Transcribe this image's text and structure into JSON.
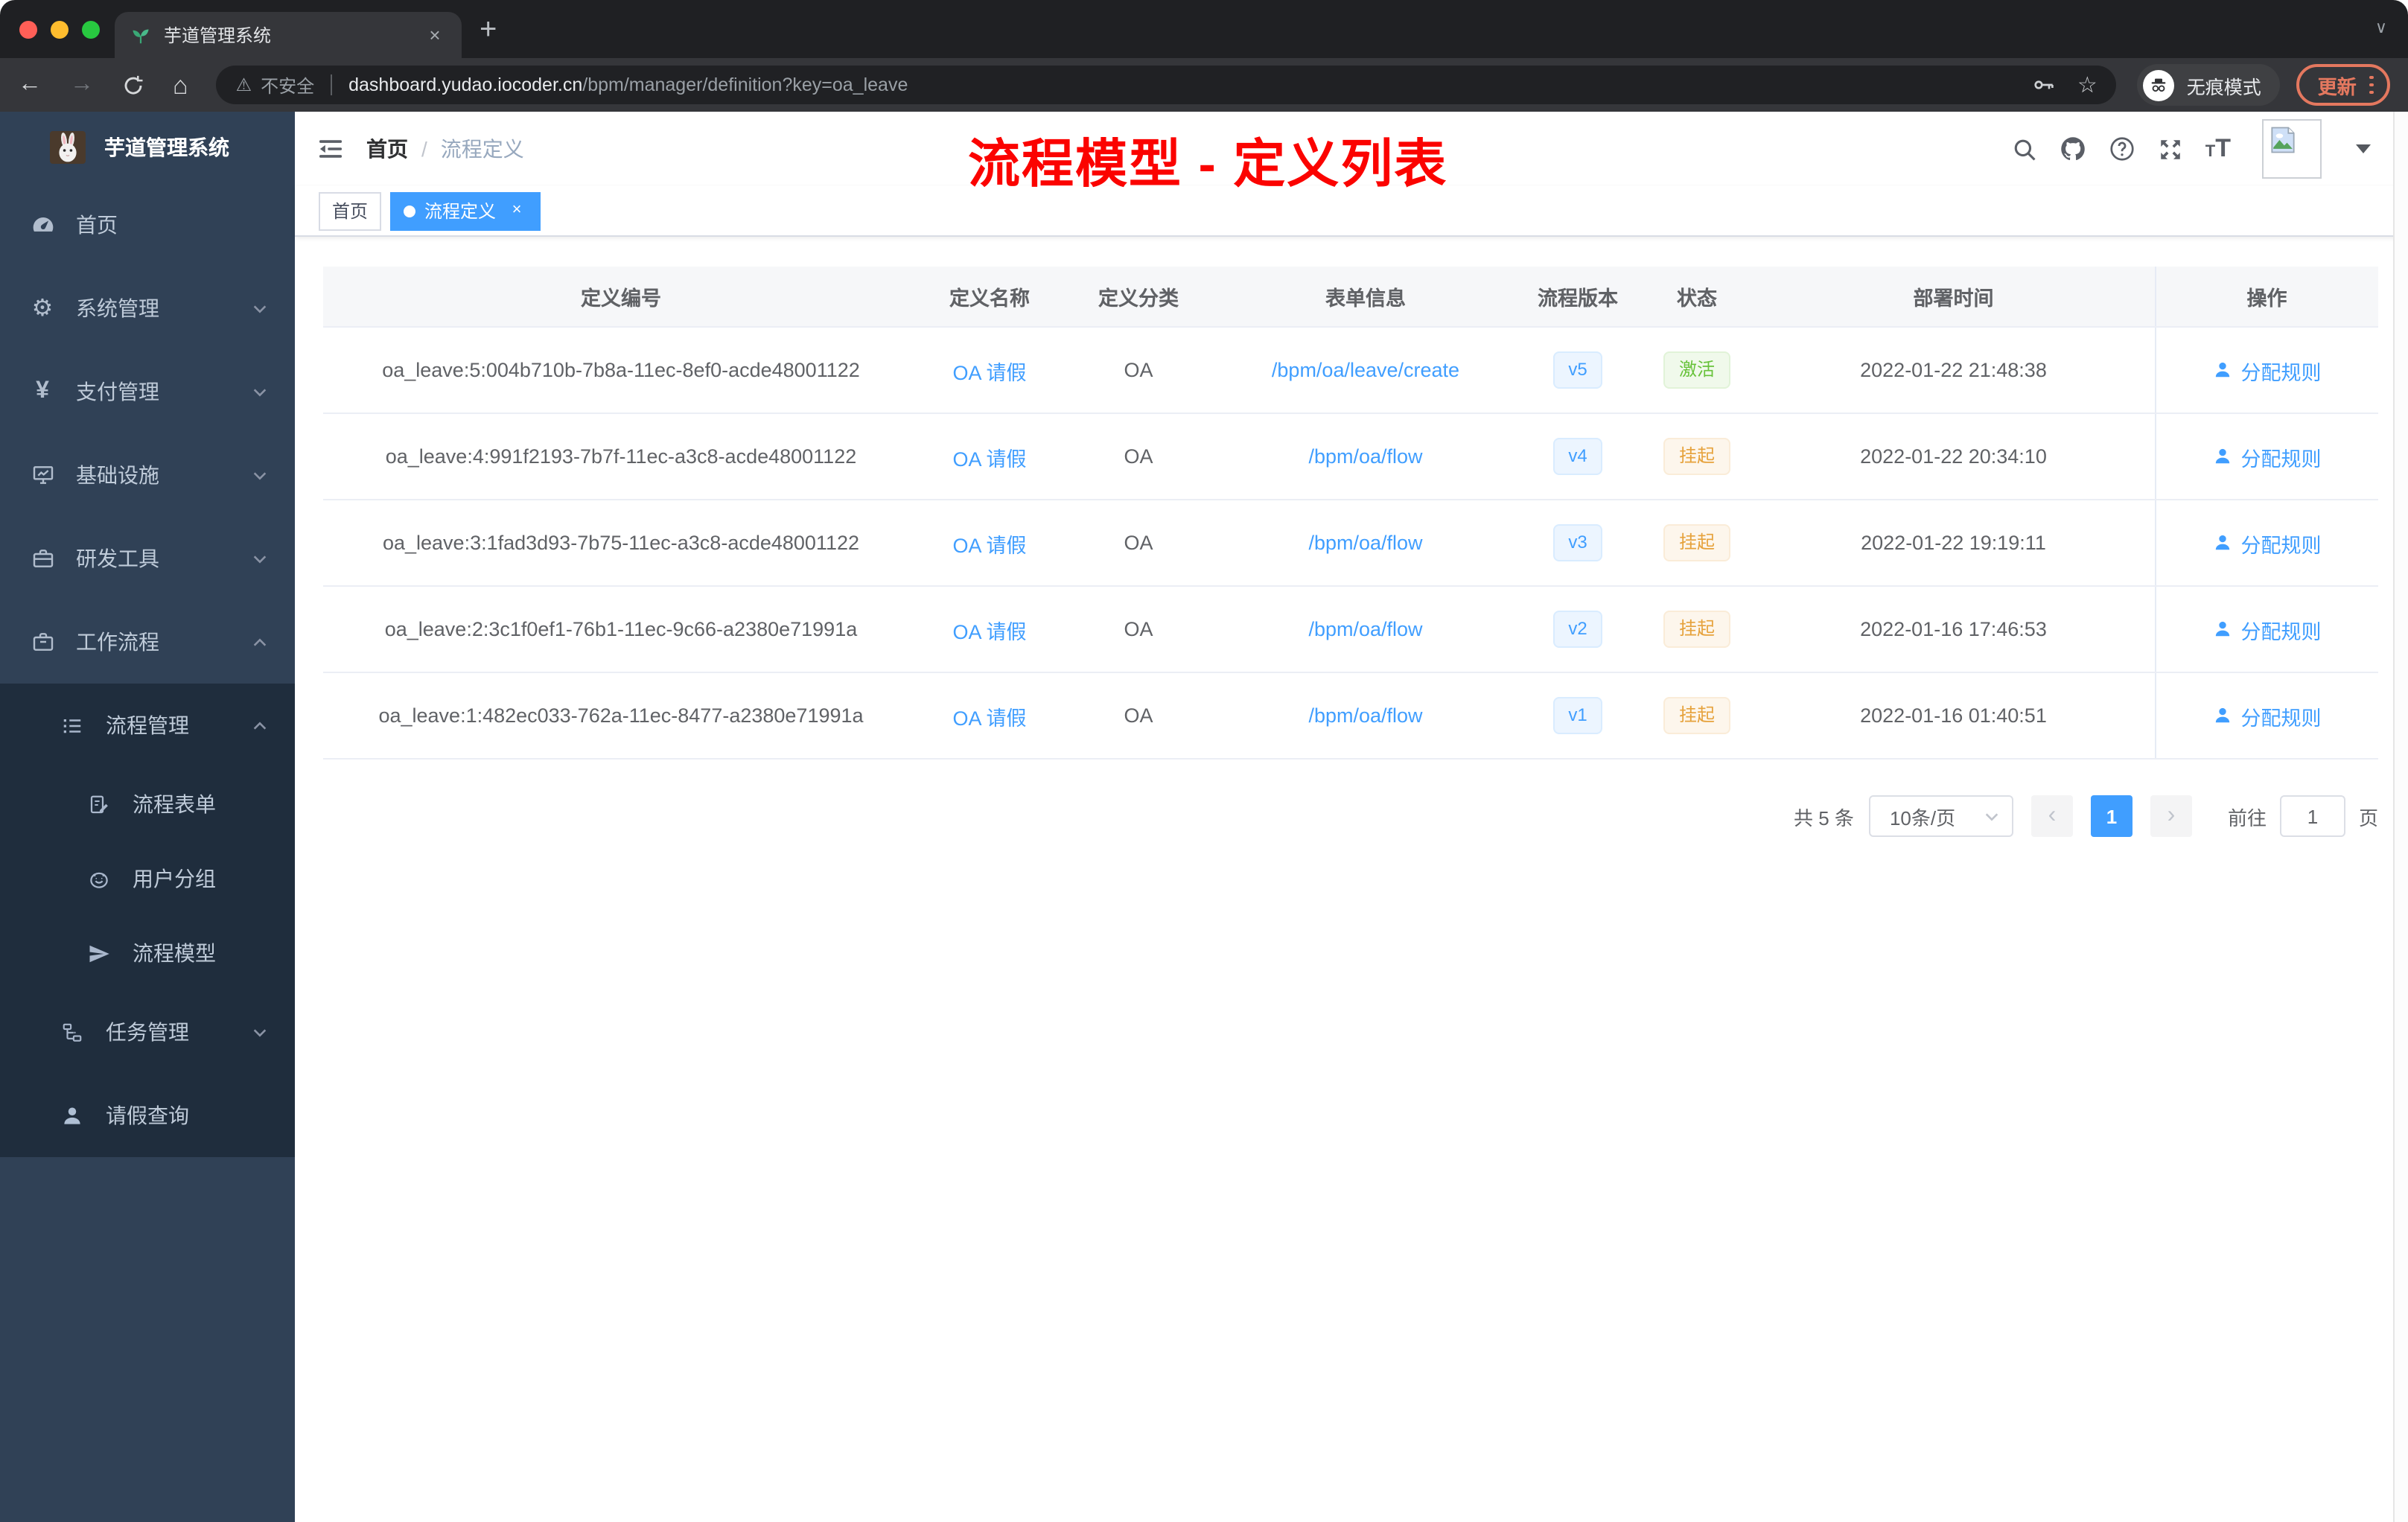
{
  "browser": {
    "tab_title": "芋道管理系统",
    "security_label": "不安全",
    "url_host": "dashboard.yudao.iocoder.cn",
    "url_path": "/bpm/manager/definition?key=oa_leave",
    "incognito_label": "无痕模式",
    "update_label": "更新"
  },
  "icons": {
    "back": "←",
    "forward": "→",
    "home": "⌂",
    "warning": "⚠",
    "star": "☆",
    "close": "×",
    "plus": "+",
    "tab_caret": "∨",
    "prev": "‹",
    "next": "›",
    "gear": "⚙",
    "yen": "¥",
    "t_small": "T",
    "t_big": "T"
  },
  "sidebar": {
    "title": "芋道管理系统",
    "items": [
      {
        "label": "首页"
      },
      {
        "label": "系统管理"
      },
      {
        "label": "支付管理"
      },
      {
        "label": "基础设施"
      },
      {
        "label": "研发工具"
      },
      {
        "label": "工作流程"
      },
      {
        "label": "流程管理"
      },
      {
        "label": "流程表单"
      },
      {
        "label": "用户分组"
      },
      {
        "label": "流程模型"
      },
      {
        "label": "任务管理"
      },
      {
        "label": "请假查询"
      }
    ]
  },
  "header": {
    "breadcrumb": [
      "首页",
      "流程定义"
    ],
    "breadcrumb_separator": "/",
    "annotation": "流程模型 - 定义列表"
  },
  "tags": [
    {
      "label": "首页"
    },
    {
      "label": "流程定义"
    }
  ],
  "table": {
    "columns": [
      "定义编号",
      "定义名称",
      "定义分类",
      "表单信息",
      "流程版本",
      "状态",
      "部署时间",
      "操作"
    ],
    "action_label": "分配规则",
    "rows": [
      {
        "id": "oa_leave:5:004b710b-7b8a-11ec-8ef0-acde48001122",
        "name": "OA 请假",
        "category": "OA",
        "form": "/bpm/oa/leave/create",
        "version": "v5",
        "status": "激活",
        "time": "2022-01-22 21:48:38"
      },
      {
        "id": "oa_leave:4:991f2193-7b7f-11ec-a3c8-acde48001122",
        "name": "OA 请假",
        "category": "OA",
        "form": "/bpm/oa/flow",
        "version": "v4",
        "status": "挂起",
        "time": "2022-01-22 20:34:10"
      },
      {
        "id": "oa_leave:3:1fad3d93-7b75-11ec-a3c8-acde48001122",
        "name": "OA 请假",
        "category": "OA",
        "form": "/bpm/oa/flow",
        "version": "v3",
        "status": "挂起",
        "time": "2022-01-22 19:19:11"
      },
      {
        "id": "oa_leave:2:3c1f0ef1-76b1-11ec-9c66-a2380e71991a",
        "name": "OA 请假",
        "category": "OA",
        "form": "/bpm/oa/flow",
        "version": "v2",
        "status": "挂起",
        "time": "2022-01-16 17:46:53"
      },
      {
        "id": "oa_leave:1:482ec033-762a-11ec-8477-a2380e71991a",
        "name": "OA 请假",
        "category": "OA",
        "form": "/bpm/oa/flow",
        "version": "v1",
        "status": "挂起",
        "time": "2022-01-16 01:40:51"
      }
    ]
  },
  "pagination": {
    "total": "共 5 条",
    "page_size": "10条/页",
    "current_page": "1",
    "goto_label": "前往",
    "goto_value": "1",
    "page_unit": "页"
  },
  "colors": {
    "accent": "#409eff",
    "sidebar_bg": "#304156",
    "submenu_bg": "#1f2d3d",
    "status_active": "#67c23a",
    "status_suspended": "#e6a23c",
    "annotation_red": "#fb0300",
    "update_orange": "#e4785f"
  }
}
